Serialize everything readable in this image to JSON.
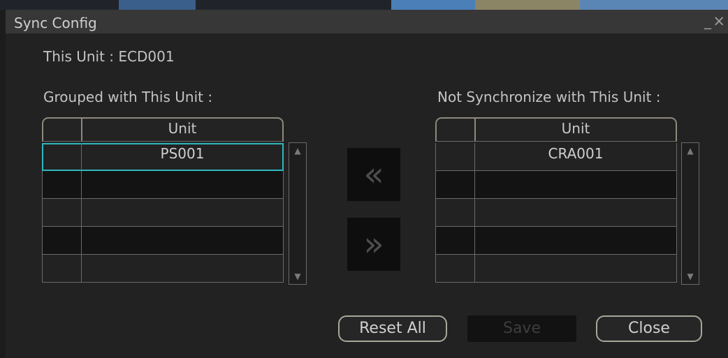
{
  "window": {
    "title": "Sync Config",
    "minimize_glyph": "_",
    "close_glyph": "×"
  },
  "this_unit_label": "This Unit : ECD001",
  "grouped": {
    "heading": "Grouped with This Unit :",
    "column_header": "Unit",
    "rows": [
      "PS001",
      "",
      "",
      "",
      ""
    ],
    "selected_row": 0
  },
  "not_sync": {
    "heading": "Not Synchronize with This Unit :",
    "column_header": "Unit",
    "rows": [
      "CRA001",
      "",
      "",
      "",
      ""
    ]
  },
  "move_left_glyph": "«",
  "move_right_glyph": "»",
  "buttons": {
    "reset_all": "Reset All",
    "save": "Save",
    "close": "Close"
  },
  "colors": {
    "selection_outline": "#2fb6bf",
    "button_border": "#a9a69a",
    "background": "#222222"
  }
}
